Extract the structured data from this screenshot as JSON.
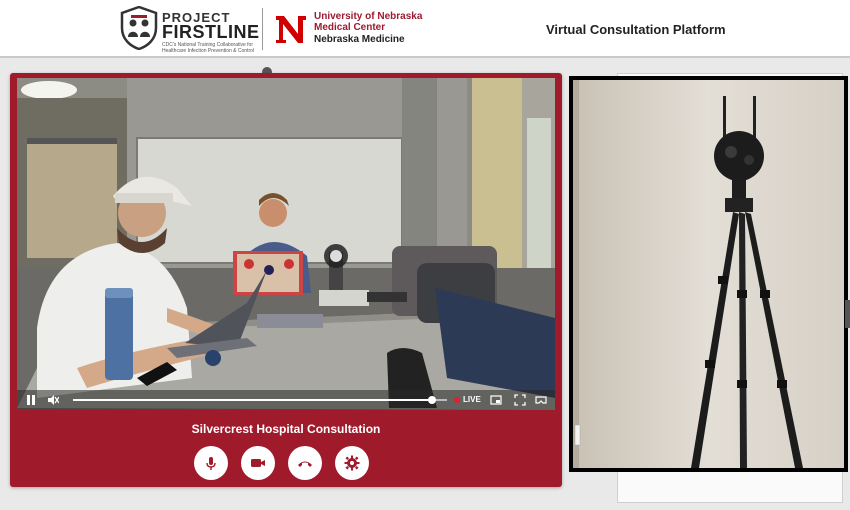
{
  "header": {
    "project_small": "PROJECT",
    "project_name": "FIRSTLINE",
    "project_tagline": "CDC's National Training Collaborative for Healthcare Infection Prevention & Control",
    "university_line1": "University of Nebraska",
    "university_line2": "Medical Center",
    "university_line3": "Nebraska Medicine",
    "platform_title": "Virtual Consultation Platform"
  },
  "consultation": {
    "title": "Silvercrest Hospital Consultation",
    "video": {
      "live_label": "LIVE",
      "progress": 0.96
    },
    "controls": [
      {
        "name": "microphone",
        "icon": "microphone-icon"
      },
      {
        "name": "camera",
        "icon": "video-camera-icon"
      },
      {
        "name": "hang-up",
        "icon": "phone-hangup-icon"
      },
      {
        "name": "settings",
        "icon": "gear-icon"
      }
    ]
  },
  "colors": {
    "brand_red": "#9f1b2b",
    "unl_red": "#d00000",
    "live_red": "#e0202a"
  }
}
